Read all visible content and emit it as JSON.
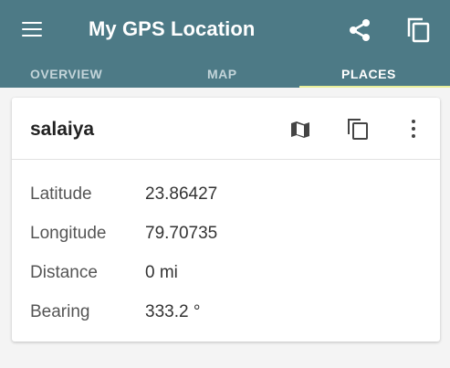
{
  "app_bar": {
    "title": "My GPS Location",
    "menu_icon": "menu-icon",
    "share_icon": "share-icon",
    "copy_icon": "copy-icon",
    "background_color": "#4d7a86"
  },
  "tabs": [
    {
      "label": "OVERVIEW",
      "active": false
    },
    {
      "label": "MAP",
      "active": false
    },
    {
      "label": "PLACES",
      "active": true
    }
  ],
  "tab_indicator_color": "#e8ef9a",
  "place_card": {
    "name": "salaiya",
    "actions": [
      "map-icon",
      "copy-icon",
      "more-vertical-icon"
    ],
    "details": [
      {
        "label": "Latitude",
        "value": "23.86427"
      },
      {
        "label": "Longitude",
        "value": "79.70735"
      },
      {
        "label": "Distance",
        "value": "0 mi"
      },
      {
        "label": "Bearing",
        "value": "333.2 °"
      }
    ]
  }
}
